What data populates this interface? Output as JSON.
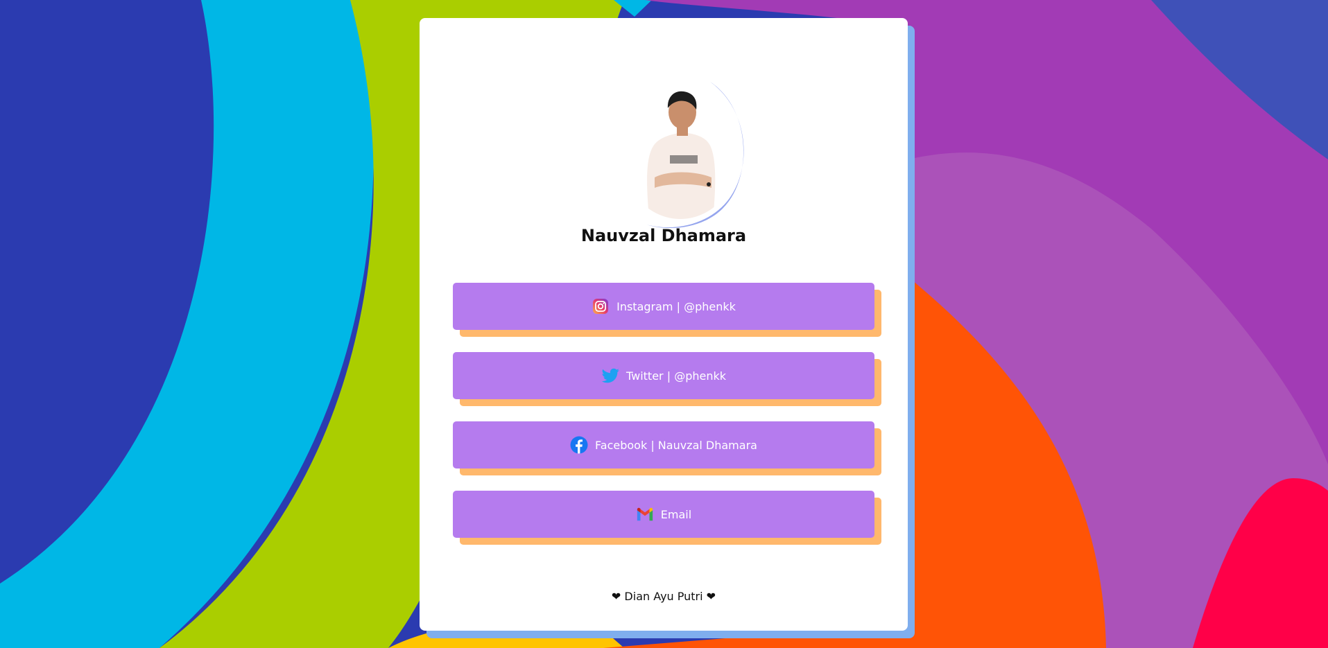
{
  "profile": {
    "name": "Nauvzal Dhamara",
    "avatar_icon": "person-photo"
  },
  "links": [
    {
      "id": "instagram",
      "label": "Instagram | @phenkk",
      "icon": "instagram-icon"
    },
    {
      "id": "twitter",
      "label": "Twitter | @phenkk",
      "icon": "twitter-icon"
    },
    {
      "id": "facebook",
      "label": "Facebook | Nauvzal Dhamara",
      "icon": "facebook-icon"
    },
    {
      "id": "email",
      "label": "Email",
      "icon": "gmail-icon"
    }
  ],
  "footer": {
    "heart_left": "❤",
    "text": "Dian Ayu Putri",
    "heart_right": "❤"
  },
  "colors": {
    "button": "#b57bee",
    "button_shadow": "#ffb86c",
    "card_shadow": "#7faeee",
    "avatar_ring": "#95a5ee"
  }
}
